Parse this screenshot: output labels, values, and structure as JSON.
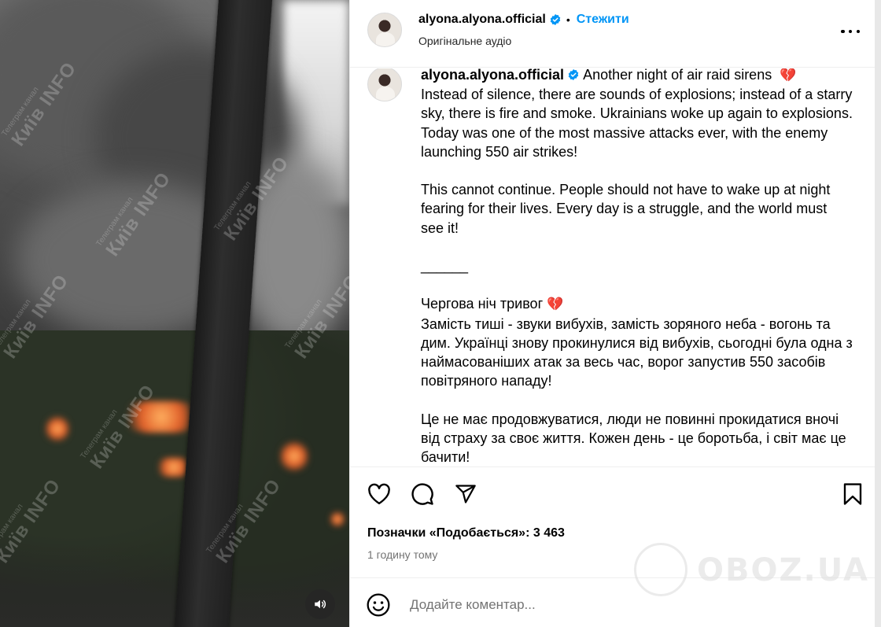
{
  "media": {
    "watermark_main": "Київ INFO",
    "watermark_sub": "Телеграм канал",
    "sound_icon": "speaker-icon"
  },
  "header": {
    "username": "alyona.alyona.official",
    "separator": "•",
    "follow_label": "Стежити",
    "audio_label": "Оригінальне аудіо",
    "more_icon": "more-options-icon"
  },
  "caption": {
    "username": "alyona.alyona.official",
    "text_en_first": "Another night of air raid sirens",
    "heart": "💔",
    "text_en_body": "Instead of silence, there are sounds of explosions; instead of a starry sky, there is fire and smoke. Ukrainians woke up again to explosions. Today was one of the most massive attacks ever, with the enemy launching 550 air strikes!\n\nThis cannot continue. People should not have to wake up at night fearing for their lives. Every day is a struggle, and the world must see it!\n\n______\n\n",
    "text_uk_first": "Чергова ніч тривог",
    "text_uk_body": "Замість тиші - звуки вибухів, замість зоряного неба - вогонь та дим. Українці знову прокинулися від вибухів, сьогодні була одна з наймасованіших атак за весь час, ворог запустив 550 засобів повітряного нападу!\n\nЦе не має продовжуватися, люди не повинні прокидатися вночі від страху за своє життя. Кожен день - це боротьба, і світ має це бачити!"
  },
  "actions": {
    "like_icon": "heart-icon",
    "comment_icon": "comment-icon",
    "share_icon": "share-icon",
    "save_icon": "bookmark-icon",
    "likes_label": "Позначки «Подобається»: 3 463",
    "time_label": "1 годину тому"
  },
  "comment": {
    "emoji_icon": "emoji-icon",
    "placeholder": "Додайте коментар..."
  },
  "watermark": {
    "text": "OBOZ.UA"
  },
  "colors": {
    "accent": "#0095f6",
    "verified": "#0095f6",
    "secondary_text": "#737373",
    "heart": "#e0245e"
  }
}
